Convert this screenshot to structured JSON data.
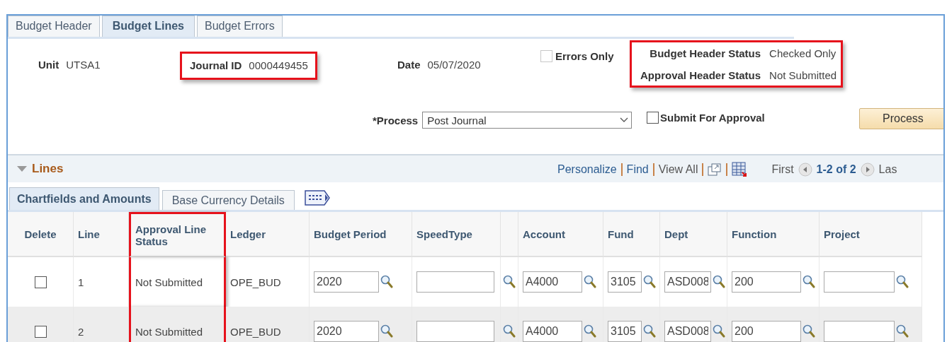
{
  "tabs": [
    {
      "label": "Budget Header",
      "selected": false
    },
    {
      "label": "Budget Lines",
      "selected": true
    },
    {
      "label": "Budget Errors",
      "selected": false
    }
  ],
  "header": {
    "unit": {
      "label": "Unit",
      "value": "UTSA1"
    },
    "journal_id": {
      "label": "Journal ID",
      "value": "0000449455",
      "highlighted": true
    },
    "date": {
      "label": "Date",
      "value": "05/07/2020"
    },
    "errors_only": {
      "label": "Errors Only",
      "checked": false,
      "disabled": true
    },
    "statuses": {
      "highlighted": true,
      "items": [
        {
          "label": "Budget Header Status",
          "value": "Checked Only"
        },
        {
          "label": "Approval Header Status",
          "value": "Not Submitted"
        }
      ]
    },
    "process": {
      "label": "*Process",
      "value": "Post Journal"
    },
    "submit_for_approval": {
      "label": "Submit For Approval",
      "checked": false
    },
    "process_button": "Process"
  },
  "lines": {
    "title": "Lines",
    "expanded": true,
    "nav": {
      "personalize": "Personalize",
      "find": "Find",
      "view_all": "View All",
      "first": "First",
      "range": "1-2 of 2",
      "last": "Las"
    },
    "subtabs": [
      {
        "label": "Chartfields and Amounts",
        "selected": true
      },
      {
        "label": "Base Currency Details",
        "selected": false
      }
    ],
    "columns": [
      {
        "label": "Delete",
        "kind": "checkbox",
        "highlighted": false
      },
      {
        "label": "Line",
        "kind": "text",
        "highlighted": false
      },
      {
        "label": "Approval Line Status",
        "kind": "text",
        "highlighted": true
      },
      {
        "label": "Ledger",
        "kind": "text",
        "highlighted": false
      },
      {
        "label": "Budget Period",
        "kind": "input",
        "highlighted": false
      },
      {
        "label": "SpeedType",
        "kind": "split_input",
        "highlighted": false
      },
      {
        "label": "Account",
        "kind": "input",
        "highlighted": false
      },
      {
        "label": "Fund",
        "kind": "input",
        "highlighted": false
      },
      {
        "label": "Dept",
        "kind": "input",
        "highlighted": false
      },
      {
        "label": "Function",
        "kind": "input",
        "highlighted": false
      },
      {
        "label": "Project",
        "kind": "input",
        "highlighted": false
      }
    ],
    "rows": [
      {
        "delete": false,
        "line": "1",
        "approval_status": "Not Submitted",
        "ledger": "OPE_BUD",
        "budget_period": "2020",
        "account": "A4000",
        "fund": "3105",
        "dept": "ASD008",
        "function": "200"
      },
      {
        "delete": false,
        "line": "2",
        "approval_status": "Not Submitted",
        "ledger": "OPE_BUD",
        "budget_period": "2020",
        "account": "A4000",
        "fund": "3105",
        "dept": "ASD008",
        "function": "200"
      }
    ]
  }
}
